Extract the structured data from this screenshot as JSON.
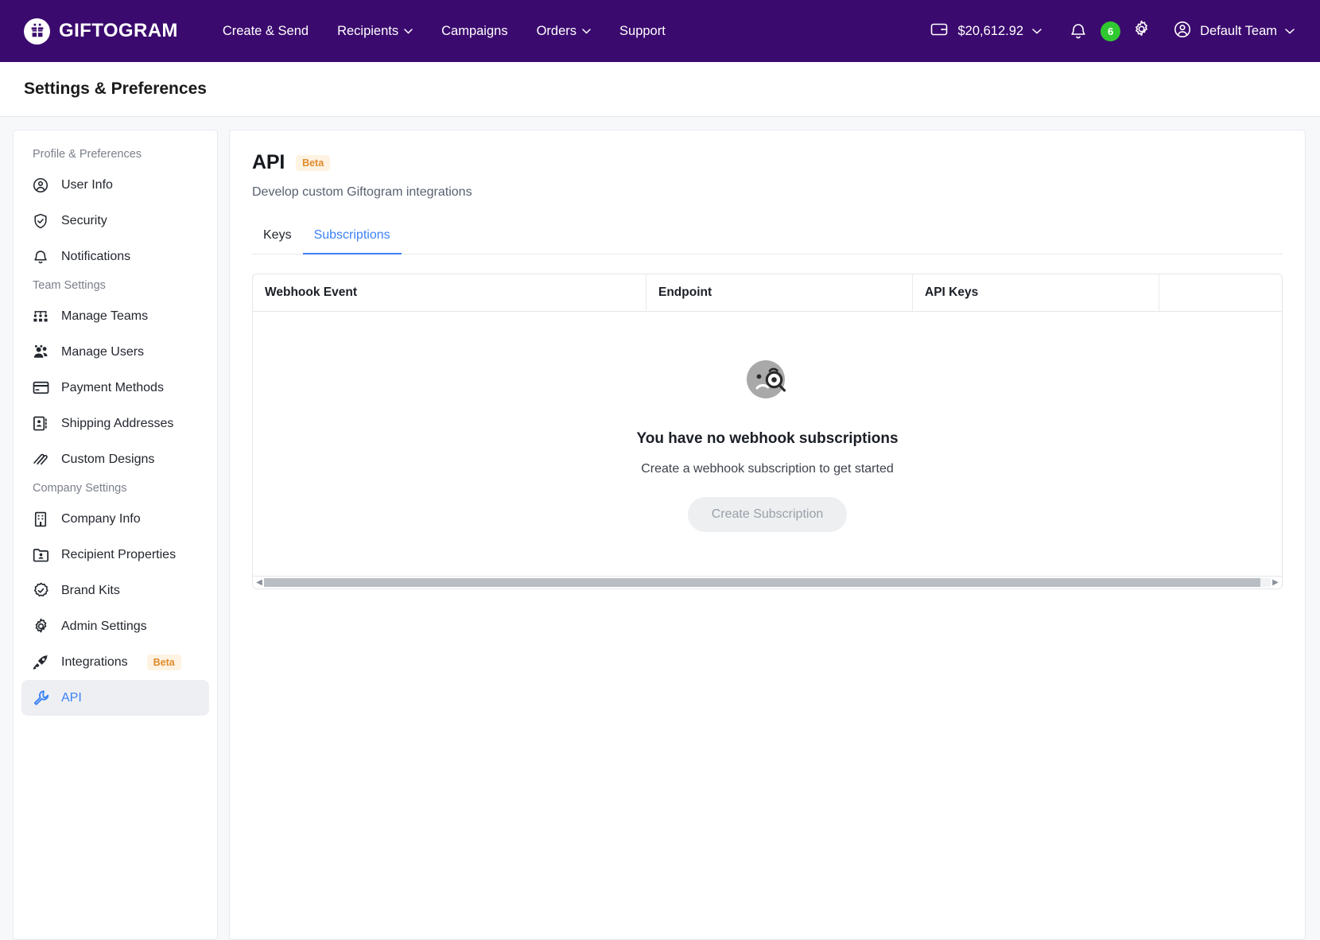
{
  "topnav": {
    "brand": "GIFTOGRAM",
    "brand_icon": "gift-box-icon",
    "links": [
      {
        "label": "Create & Send",
        "caret": false
      },
      {
        "label": "Recipients",
        "caret": true
      },
      {
        "label": "Campaigns",
        "caret": false
      },
      {
        "label": "Orders",
        "caret": true
      },
      {
        "label": "Support",
        "caret": false
      }
    ],
    "wallet": {
      "icon": "wallet-icon",
      "balance": "$20,612.92",
      "caret": "⌄"
    },
    "notifications": {
      "icon": "bell-icon",
      "count": "6",
      "badge_color": "#30C830"
    },
    "settings_icon": "gear-icon",
    "team": {
      "icon": "user-circle-icon",
      "label": "Default Team",
      "caret": "⌄"
    },
    "bg_color": "#3B0A6E"
  },
  "page": {
    "title": "Settings & Preferences"
  },
  "sidebar": {
    "groups": [
      {
        "label": "Profile & Preferences",
        "items": [
          {
            "label": "User Info",
            "icon": "user-circle-icon",
            "active": false
          },
          {
            "label": "Security",
            "icon": "shield-check-icon",
            "active": false
          },
          {
            "label": "Notifications",
            "icon": "bell-icon",
            "active": false
          }
        ]
      },
      {
        "label": "Team Settings",
        "items": [
          {
            "label": "Manage Teams",
            "icon": "org-chart-icon",
            "active": false
          },
          {
            "label": "Manage Users",
            "icon": "users-icon",
            "active": false
          },
          {
            "label": "Payment Methods",
            "icon": "credit-card-icon",
            "active": false
          },
          {
            "label": "Shipping Addresses",
            "icon": "address-card-icon",
            "active": false
          },
          {
            "label": "Custom Designs",
            "icon": "scribble-icon",
            "active": false
          }
        ]
      },
      {
        "label": "Company Settings",
        "items": [
          {
            "label": "Company Info",
            "icon": "building-icon",
            "active": false
          },
          {
            "label": "Recipient Properties",
            "icon": "contact-folder-icon",
            "active": false
          },
          {
            "label": "Brand Kits",
            "icon": "badge-check-icon",
            "active": false
          },
          {
            "label": "Admin Settings",
            "icon": "gear-icon",
            "active": false
          },
          {
            "label": "Integrations",
            "icon": "rocket-icon",
            "active": false,
            "badge": "Beta"
          },
          {
            "label": "API",
            "icon": "wrench-icon",
            "active": true
          }
        ]
      }
    ]
  },
  "main": {
    "title": "API",
    "title_badge": "Beta",
    "subtitle": "Develop custom Giftogram integrations",
    "tabs": [
      {
        "label": "Keys",
        "active": false
      },
      {
        "label": "Subscriptions",
        "active": true
      }
    ],
    "table": {
      "columns": [
        "Webhook Event",
        "Endpoint",
        "API Keys",
        ""
      ]
    },
    "empty_state": {
      "illustration": "confused-face-magnifier-icon",
      "title": "You have no webhook subscriptions",
      "subtitle": "Create a webhook subscription to get started",
      "button_label": "Create Subscription",
      "button_disabled": true
    },
    "scrollbar": {
      "left_arrow": "◀",
      "right_arrow": "▶"
    }
  },
  "colors": {
    "brand_purple": "#3B0A6E",
    "accent_blue": "#3B82F6",
    "beta_orange": "#E08A2B",
    "beta_bg": "#FEF3E2",
    "badge_green": "#30C830"
  }
}
